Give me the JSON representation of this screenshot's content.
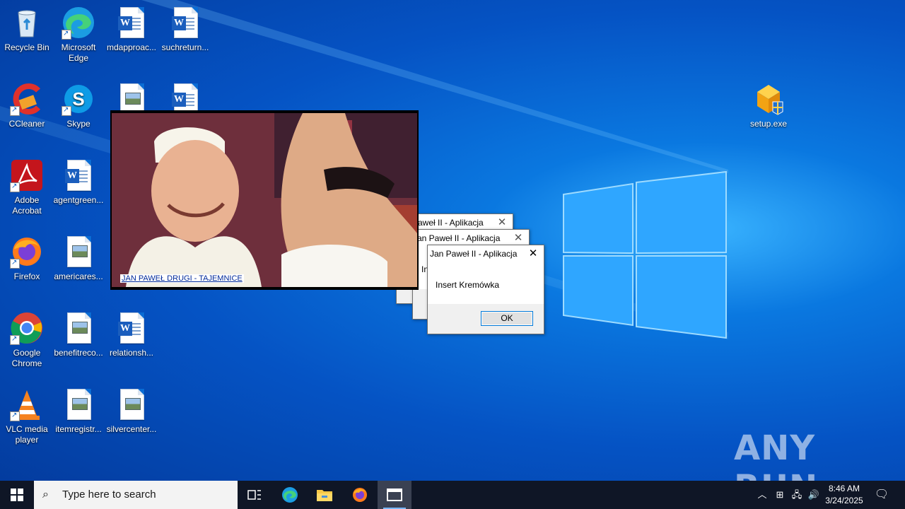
{
  "desktop": {
    "icons": [
      {
        "label": "Recycle Bin",
        "icon": "recycle-bin-icon"
      },
      {
        "label": "Microsoft Edge",
        "icon": "edge-icon"
      },
      {
        "label": "mdapproac...",
        "icon": "word-document-icon"
      },
      {
        "label": "suchreturn...",
        "icon": "word-document-icon"
      },
      {
        "label": "CCleaner",
        "icon": "ccleaner-icon"
      },
      {
        "label": "Skype",
        "icon": "skype-icon"
      },
      {
        "label": "Adobe Acrobat",
        "icon": "acrobat-icon"
      },
      {
        "label": "agentgreen...",
        "icon": "word-document-icon"
      },
      {
        "label": "Firefox",
        "icon": "firefox-icon"
      },
      {
        "label": "americares...",
        "icon": "image-file-icon"
      },
      {
        "label": "Google Chrome",
        "icon": "chrome-icon"
      },
      {
        "label": "benefitreco...",
        "icon": "image-file-icon"
      },
      {
        "label": "relationsh...",
        "icon": "word-document-icon"
      },
      {
        "label": "VLC media player",
        "icon": "vlc-icon"
      },
      {
        "label": "itemregistr...",
        "icon": "image-file-icon"
      },
      {
        "label": "silvercenter...",
        "icon": "image-file-icon"
      },
      {
        "label": "setup.exe",
        "icon": "setup-exe-icon"
      }
    ]
  },
  "viewer": {
    "caption": "JAN PAWEŁ DRUGI - TAJEMNICE"
  },
  "dialogs": {
    "back2": {
      "title": "Jan Paweł II - Aplikacja",
      "partial_title": "aweł II - Aplikacja"
    },
    "back1": {
      "title": "Jan Paweł II - Aplikacja",
      "partial_title": "an Paweł II - Aplikacja",
      "partial_msg": "In"
    },
    "front": {
      "title": "Jan Paweł II - Aplikacja",
      "message": "Insert Kremówka",
      "ok_label": "OK"
    }
  },
  "taskbar": {
    "search_placeholder": "Type here to search",
    "time": "8:46 AM",
    "date": "3/24/2025"
  },
  "watermark": "ANY RUN"
}
